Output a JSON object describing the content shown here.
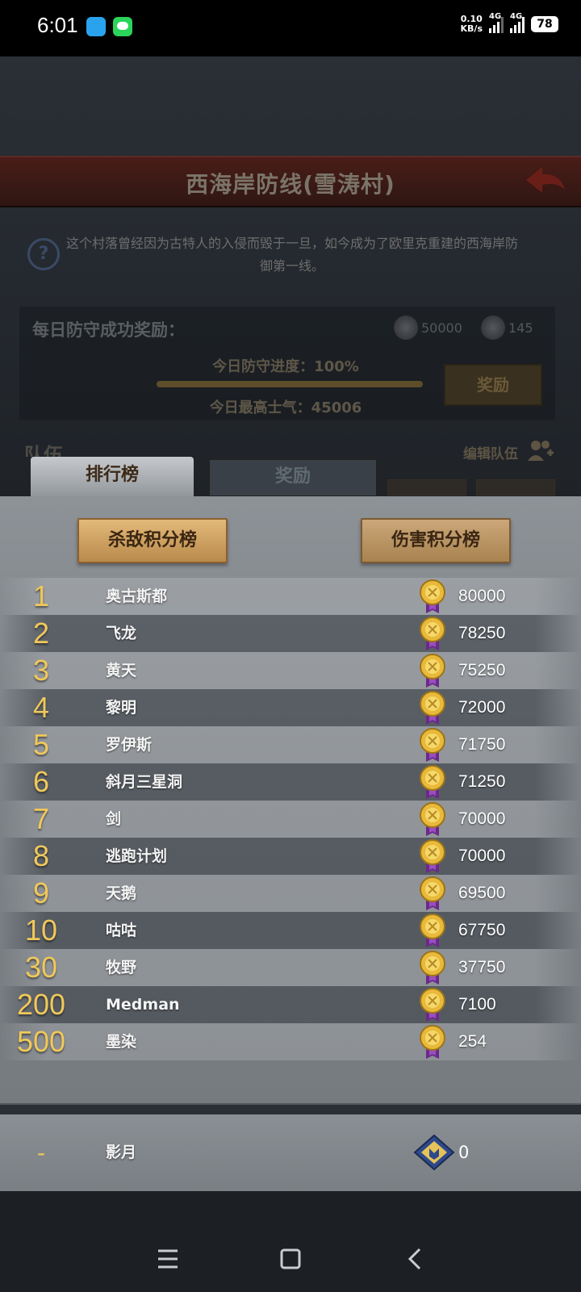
{
  "status_bar": {
    "time": "6:01",
    "net_speed_value": "0.10",
    "net_speed_unit": "KB/s",
    "signal1": "4G",
    "signal2": "4G",
    "battery": "78"
  },
  "header": {
    "title": "西海岸防线(雪涛村)",
    "description": "这个村落曾经因为古特人的入侵而毁于一旦，如今成为了欧里克重建的西海岸防御第一线。"
  },
  "daily_reward": {
    "label": "每日防守成功奖励：",
    "resource1": "50000",
    "resource2": "145",
    "progress_label": "今日防守进度：100%",
    "progress": 1.0,
    "morale_label": "今日最高士气：45006",
    "claim_button": "奖励"
  },
  "team": {
    "label": "队伍",
    "edit_label": "编辑队伍"
  },
  "tabs": {
    "ranking": "排行榜",
    "rewards": "奖励"
  },
  "sort_buttons": {
    "kill": "杀敌积分榜",
    "damage": "伤害积分榜"
  },
  "leaderboard": [
    {
      "rank": "1",
      "name": "奥古斯都",
      "score": "80000"
    },
    {
      "rank": "2",
      "name": "飞龙",
      "score": "78250"
    },
    {
      "rank": "3",
      "name": "黄天",
      "score": "75250"
    },
    {
      "rank": "4",
      "name": "黎明",
      "score": "72000"
    },
    {
      "rank": "5",
      "name": "罗伊斯",
      "score": "71750"
    },
    {
      "rank": "6",
      "name": "斜月三星洞",
      "score": "71250"
    },
    {
      "rank": "7",
      "name": "剑",
      "score": "70000"
    },
    {
      "rank": "8",
      "name": "逃跑计划",
      "score": "70000"
    },
    {
      "rank": "9",
      "name": "天鹅",
      "score": "69500"
    },
    {
      "rank": "10",
      "name": "咕咕",
      "score": "67750"
    },
    {
      "rank": "30",
      "name": "牧野",
      "score": "37750"
    },
    {
      "rank": "200",
      "name": "Medman",
      "score": "7100"
    },
    {
      "rank": "500",
      "name": "墨染",
      "score": "254"
    }
  ],
  "self": {
    "rank": "-",
    "name": "影月",
    "score": "0"
  },
  "colors": {
    "rank_gold": "#f0c85a",
    "medal_ribbon": "#6a2a8a",
    "button_gold": "#e3b979"
  },
  "icons": {
    "medal": "gold-medal-icon",
    "self_badge": "rank-badge-icon",
    "help": "help-icon",
    "back": "back-arrow-icon"
  }
}
